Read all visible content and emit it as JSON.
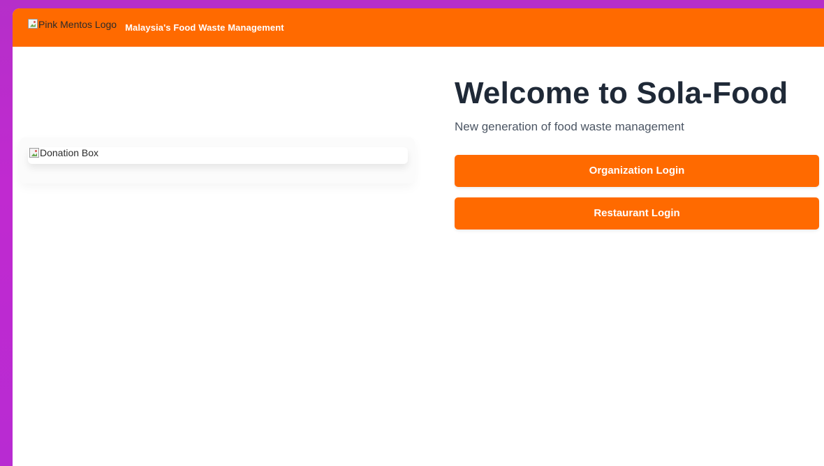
{
  "header": {
    "logo_alt": "Pink Mentos Logo",
    "tagline": "Malaysia's Food Waste Management"
  },
  "hero": {
    "image_alt": "Donation Box",
    "title": "Welcome to Sola-Food",
    "subtitle": "New generation of food waste management"
  },
  "actions": {
    "organization_login": "Organization Login",
    "restaurant_login": "Restaurant Login"
  },
  "colors": {
    "brand": "#ff6a00",
    "background": "#c02ad0",
    "title": "#1f2937",
    "subtitle": "#4b5563"
  },
  "icons": {
    "broken_image": "broken-image-icon"
  }
}
